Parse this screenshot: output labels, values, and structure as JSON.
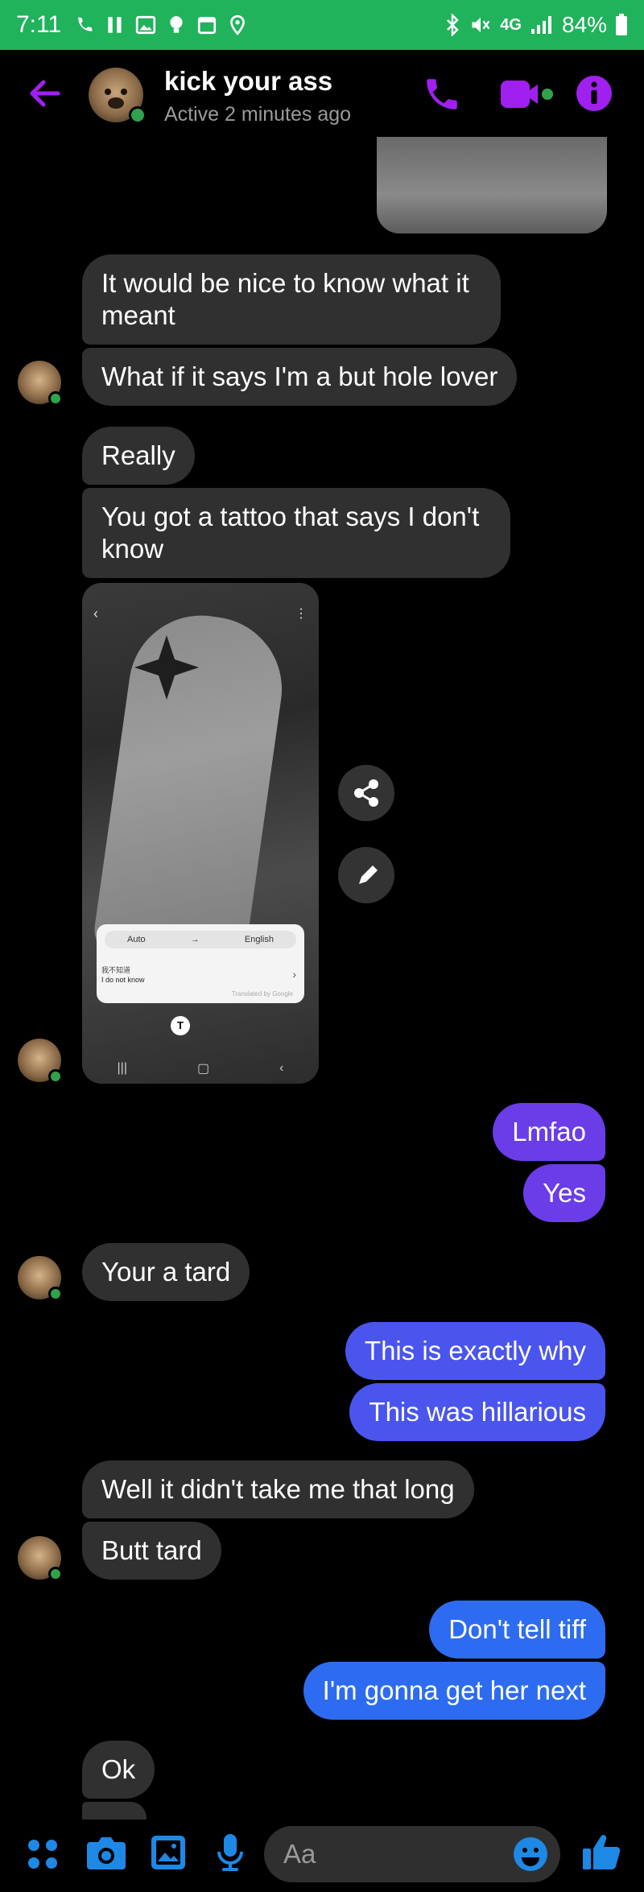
{
  "status_bar": {
    "time": "7:11",
    "left_icons": [
      "phone-wifi-icon",
      "pause-icon",
      "gallery-icon",
      "bulb-icon",
      "calendar-icon",
      "location-icon"
    ],
    "network": "4G",
    "battery": "84%"
  },
  "header": {
    "contact_name": "kick your ass",
    "active_status": "Active 2 minutes ago"
  },
  "messages": [
    {
      "id": "m1",
      "direction": "incoming",
      "text": "It would be nice to know what it meant"
    },
    {
      "id": "m2",
      "direction": "incoming",
      "text": "What if it says I'm a but hole lover"
    },
    {
      "id": "m3",
      "direction": "incoming",
      "text": "Really"
    },
    {
      "id": "m4",
      "direction": "incoming",
      "text": "You got a tattoo that says I don't know"
    },
    {
      "id": "m5",
      "direction": "outgoing",
      "text": "Lmfao"
    },
    {
      "id": "m6",
      "direction": "outgoing",
      "text": "Yes"
    },
    {
      "id": "m7",
      "direction": "incoming",
      "text": "Your a tard"
    },
    {
      "id": "m8",
      "direction": "outgoing",
      "text": "This is exactly why"
    },
    {
      "id": "m9",
      "direction": "outgoing",
      "text": "This was hillarious"
    },
    {
      "id": "m10",
      "direction": "incoming",
      "text": "Well it didn't take me that long"
    },
    {
      "id": "m11",
      "direction": "incoming",
      "text": "Butt tard"
    },
    {
      "id": "m12",
      "direction": "outgoing",
      "text": "Don't tell tiff"
    },
    {
      "id": "m13",
      "direction": "outgoing",
      "text": "I'm gonna get her next"
    },
    {
      "id": "m14",
      "direction": "incoming",
      "text": "Ok"
    }
  ],
  "attachment": {
    "translate_source": "Auto",
    "translate_arrow": "→",
    "translate_target": "English",
    "source_text": "我不知道",
    "result_text": "I do not know",
    "translated_by": "Translated by Google"
  },
  "composer": {
    "placeholder": "Aa"
  },
  "colors": {
    "status_bar": "#21b25c",
    "accent": "#a020f0",
    "incoming_bubble": "#303030",
    "outgoing_purple": "#6a3de8",
    "outgoing_blue": "#2d6cf0",
    "composer_icons": "#1e88e5"
  }
}
